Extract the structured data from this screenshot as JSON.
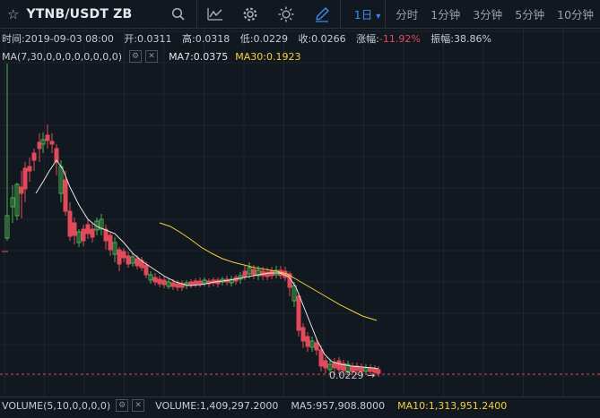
{
  "header": {
    "symbol": "YTNB/USDT ZB",
    "icons": [
      "star-icon",
      "search-icon",
      "indicator-icon",
      "settings-icon",
      "theme-icon",
      "draw-icon"
    ],
    "periods": [
      "1日",
      "分时",
      "1分钟",
      "3分钟",
      "5分钟",
      "10分钟"
    ],
    "active_period": "1日",
    "period_dropdown": "▾"
  },
  "ohlc": {
    "time": "时间:2019-09-03 08:00",
    "open": "开:0.0311",
    "high": "高:0.0318",
    "low": "低:0.0229",
    "close": "收:0.0266",
    "change_label": "涨幅:",
    "change_value": "-11.92%",
    "amplitude": "振幅:38.86%"
  },
  "ma": {
    "params": "MA(7,30,0,0,0,0,0,0,0,0)",
    "ma7": "MA7:0.0375",
    "ma30": "MA30:0.1923"
  },
  "price_tag": "0.0229 →",
  "volume": {
    "params": "VOLUME(5,10,0,0,0,0)",
    "volume": "VOLUME:1,409,297.2000",
    "ma5": "MA5:957,908.8000",
    "ma10": "MA10:1,313,951.2400"
  },
  "colors": {
    "background": "#121820",
    "up": "#4caf50",
    "down": "#e04a5a",
    "ma7": "#e6e6e6",
    "ma30": "#f3d03a",
    "accent": "#3b8ef0"
  },
  "chart_data": {
    "type": "candlestick",
    "last_price": 0.0229,
    "ma_lines": [
      "MA7",
      "MA30"
    ]
  }
}
